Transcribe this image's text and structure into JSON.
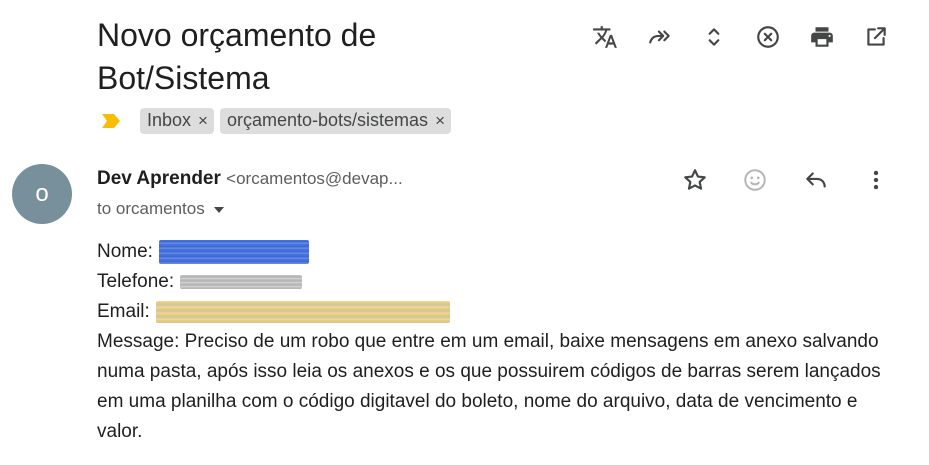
{
  "subject": "Novo orçamento de Bot/Sistema",
  "top_actions": [
    {
      "name": "translate-icon",
      "label": "Translate"
    },
    {
      "name": "forward-all-icon",
      "label": "Forward all"
    },
    {
      "name": "expand-collapse-icon",
      "label": "Expand all"
    },
    {
      "name": "close-circle-icon",
      "label": "Close"
    },
    {
      "name": "print-icon",
      "label": "Print all"
    },
    {
      "name": "open-new-window-icon",
      "label": "In new window"
    }
  ],
  "importance_marker": {
    "icon": "importance-marker-icon",
    "color": "#fbbc04"
  },
  "labels": [
    {
      "text": "Inbox",
      "remove": "×"
    },
    {
      "text": "orçamento-bots/sistemas",
      "remove": "×"
    }
  ],
  "sender": {
    "avatar_initial": "o",
    "avatar_color": "#788f9c",
    "name": "Dev Aprender",
    "email": "<orcamentos@devap...",
    "to": "to orcamentos"
  },
  "message_actions": [
    {
      "name": "star-icon"
    },
    {
      "name": "add-reaction-icon"
    },
    {
      "name": "reply-icon"
    },
    {
      "name": "more-options-icon"
    }
  ],
  "body": {
    "name_label": "Nome:",
    "phone_label": "Telefone:",
    "email_label": "Email:",
    "message": "Message: Preciso de um robo que entre em um email, baixe mensagens em anexo salvando numa pasta, após isso leia os anexos e os que possuirem códigos de barras serem lançados em uma planilha com o código digitavel do boleto, nome do arquivo, data de vencimento e valor."
  },
  "colors": {
    "accent_text": "#1f1f1f",
    "muted_text": "#5e5e5e",
    "chip_bg": "#dddddd"
  }
}
